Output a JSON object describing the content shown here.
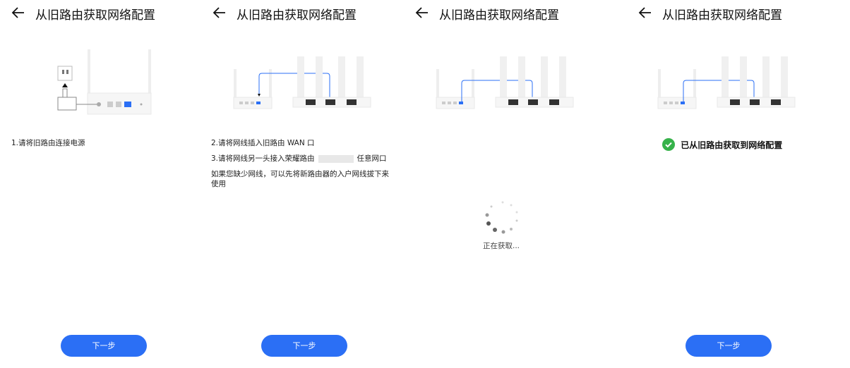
{
  "panels": [
    {
      "title": "从旧路由获取网络配置",
      "step": "1.请将旧路由连接电源",
      "button": "下一步"
    },
    {
      "title": "从旧路由获取网络配置",
      "step2": "2.请将网线插入旧路由 WAN 口",
      "step3a": "3.请将网线另一头接入荣耀路由",
      "step3b": "任意网口",
      "hint": "如果您缺少网线，可以先将新路由器的入户网线拔下来使用",
      "button": "下一步"
    },
    {
      "title": "从旧路由获取网络配置",
      "loading": "正在获取..."
    },
    {
      "title": "从旧路由获取网络配置",
      "success": "已从旧路由获取到网络配置",
      "button": "下一步"
    }
  ],
  "colors": {
    "accent": "#2b6ff5",
    "success": "#36b24a"
  }
}
